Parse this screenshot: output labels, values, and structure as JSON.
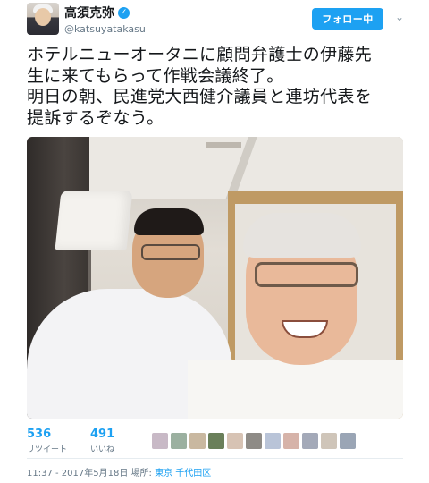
{
  "user": {
    "display_name": "高須克弥",
    "handle": "@katsuyatakasu",
    "verified_symbol": "✓"
  },
  "follow_button_label": "フォロー中",
  "more_symbol": "⌄",
  "tweet_text": "ホテルニューオータニに顧問弁護士の伊藤先\n生に来てもらって作戦会議終了。\n明日の朝、民進党大西健介議員と連坊代表を\n提訴するぞなう。",
  "stats": [
    {
      "value": "536",
      "label": "リツイート"
    },
    {
      "value": "491",
      "label": "いいね"
    }
  ],
  "liker_avatar_colors": [
    "#c8b9c6",
    "#9bb0a0",
    "#c9b8a0",
    "#6a7f5a",
    "#d7c3b4",
    "#8e8b86",
    "#b9c4d8",
    "#d6b3a9",
    "#a3a9b8",
    "#cfc5b9",
    "#9aa5b5"
  ],
  "meta": {
    "time_date": "11:37 - 2017年5月18日",
    "location_label": "場所:",
    "location": "東京 千代田区"
  },
  "colors": {
    "accent": "#1da1f2",
    "text": "#14171a",
    "muted": "#657786"
  }
}
